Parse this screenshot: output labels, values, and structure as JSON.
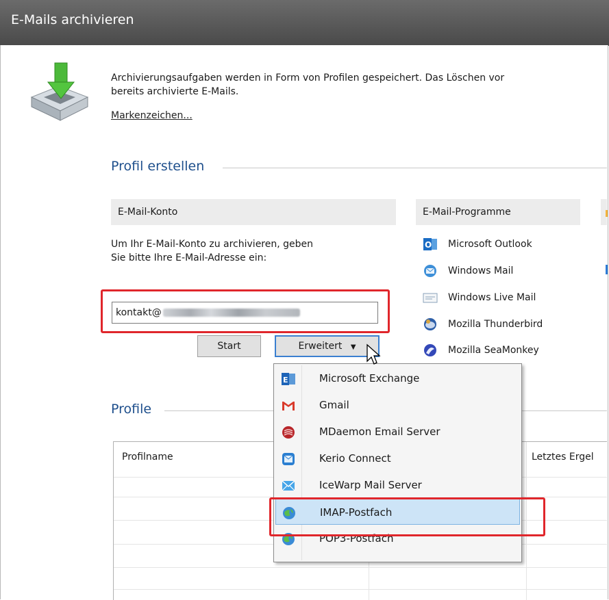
{
  "window": {
    "title": "E-Mails archivieren"
  },
  "intro": {
    "line1": "Archivierungsaufgaben werden in Form von Profilen gespeichert. Das Löschen vor",
    "line2": "bereits archivierte E-Mails.",
    "link": "Markenzeichen..."
  },
  "create_section": {
    "title": "Profil erstellen",
    "account": {
      "header": "E-Mail-Konto",
      "desc_line1": "Um Ihr E-Mail-Konto zu archivieren, geben",
      "desc_line2": "Sie bitte Ihre E-Mail-Adresse ein:",
      "email_value": "kontakt@",
      "start_button": "Start",
      "advanced_button": "Erweitert"
    },
    "programs": {
      "header": "E-Mail-Programme",
      "items": [
        {
          "label": "Microsoft Outlook",
          "icon": "outlook-icon"
        },
        {
          "label": "Windows Mail",
          "icon": "windows-mail-icon"
        },
        {
          "label": "Windows Live Mail",
          "icon": "windows-live-mail-icon"
        },
        {
          "label": "Mozilla Thunderbird",
          "icon": "thunderbird-icon"
        },
        {
          "label": "Mozilla SeaMonkey",
          "icon": "seamonkey-icon"
        }
      ]
    }
  },
  "dropdown": {
    "items": [
      {
        "label": "Microsoft Exchange",
        "icon": "exchange-icon"
      },
      {
        "label": "Gmail",
        "icon": "gmail-icon"
      },
      {
        "label": "MDaemon Email Server",
        "icon": "mdaemon-icon"
      },
      {
        "label": "Kerio Connect",
        "icon": "kerio-icon"
      },
      {
        "label": "IceWarp Mail Server",
        "icon": "icewarp-icon"
      },
      {
        "label": "IMAP-Postfach",
        "icon": "imap-globe-icon",
        "selected": true
      },
      {
        "label": "POP3-Postfach",
        "icon": "pop3-globe-icon"
      }
    ]
  },
  "profiles": {
    "title": "Profile",
    "columns": [
      "Profilname",
      "Letztes Ergel"
    ]
  },
  "colors": {
    "accent_blue": "#1e4f8c",
    "highlight_red": "#e0262b",
    "selection": "#cde4f7"
  }
}
